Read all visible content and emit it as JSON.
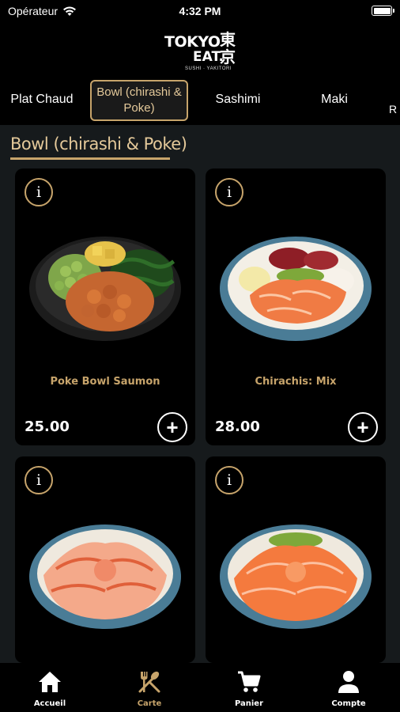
{
  "status_bar": {
    "carrier": "Opérateur",
    "time": "4:32 PM"
  },
  "brand": {
    "line1": "TOKYO",
    "line2": "EAT.",
    "kanji": "東京",
    "tagline": "SUSHI · YAKITORI"
  },
  "tabs": [
    {
      "label": "Plat Chaud",
      "active": false
    },
    {
      "label": "Bowl (chirashi & Poke)",
      "active": true
    },
    {
      "label": "Sashimi",
      "active": false
    },
    {
      "label": "Maki",
      "active": false
    },
    {
      "label": "R",
      "active": false
    }
  ],
  "section": {
    "title": "Bowl (chirashi & Poke)"
  },
  "products": [
    {
      "name": "Poke Bowl Saumon",
      "price": "25.00",
      "info_glyph": "i",
      "add_glyph": "+",
      "dish": "poke-bowl"
    },
    {
      "name": "Chirachis: Mix",
      "price": "28.00",
      "info_glyph": "i",
      "add_glyph": "+",
      "dish": "chirashi-mix"
    },
    {
      "name": "",
      "price": "",
      "info_glyph": "i",
      "add_glyph": "+",
      "dish": "seared-salmon-bowl"
    },
    {
      "name": "",
      "price": "",
      "info_glyph": "i",
      "add_glyph": "+",
      "dish": "salmon-bowl"
    }
  ],
  "bottom_nav": [
    {
      "label": "Accueil",
      "icon": "home-icon",
      "active": false
    },
    {
      "label": "Carte",
      "icon": "utensils-icon",
      "active": true
    },
    {
      "label": "Panier",
      "icon": "cart-icon",
      "active": false
    },
    {
      "label": "Compte",
      "icon": "user-icon",
      "active": false
    }
  ],
  "colors": {
    "background": "#161a1c",
    "card": "#000000",
    "accent_gold": "#c7a46b",
    "accent_text": "#e4c99a"
  }
}
